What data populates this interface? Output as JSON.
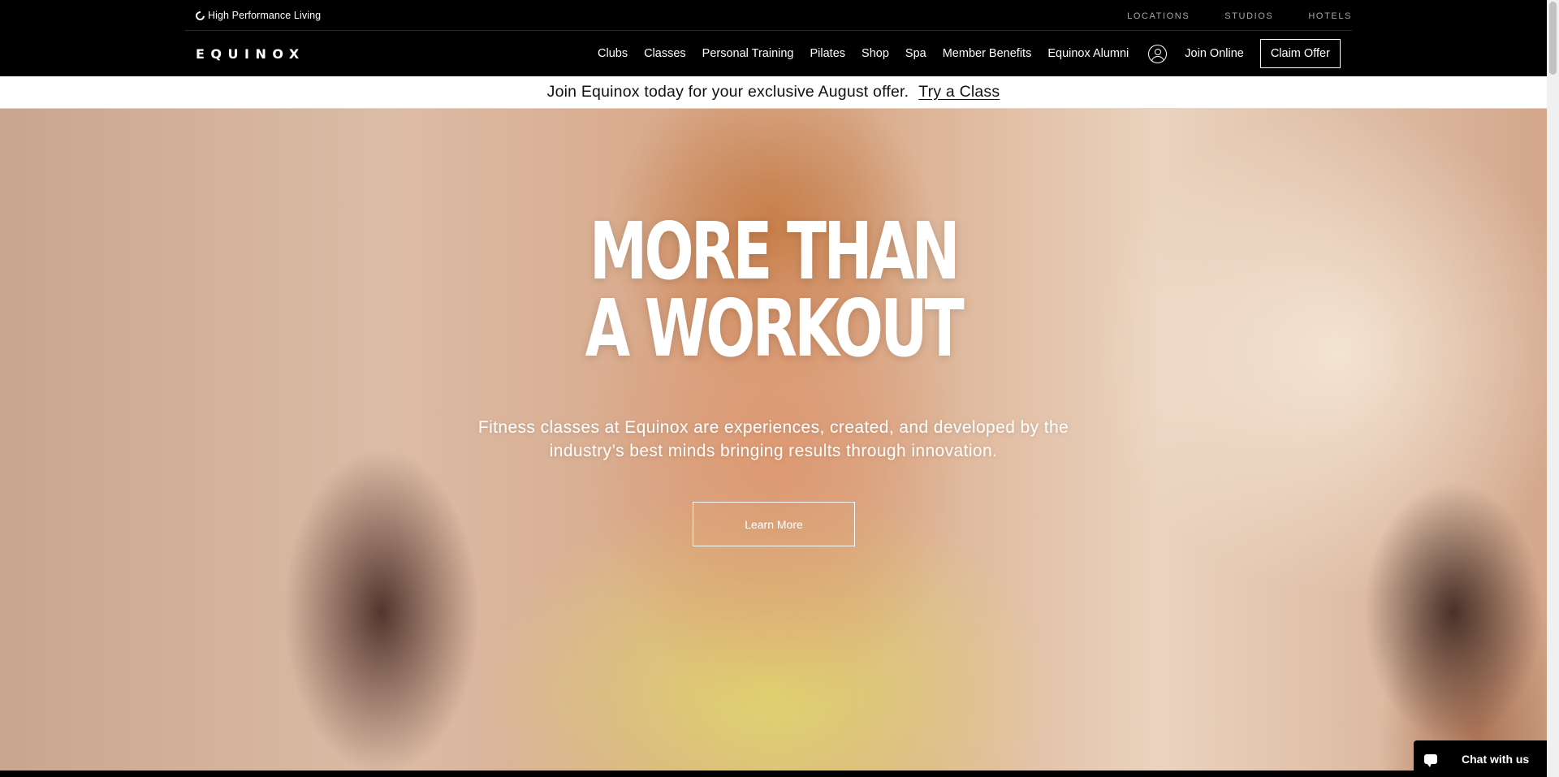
{
  "utility_bar": {
    "tagline": "High Performance Living",
    "links": [
      "LOCATIONS",
      "STUDIOS",
      "HOTELS"
    ]
  },
  "nav": {
    "logo": "EQUINOX",
    "items": [
      "Clubs",
      "Classes",
      "Personal Training",
      "Pilates",
      "Shop",
      "Spa",
      "Member Benefits",
      "Equinox Alumni"
    ],
    "join_online": "Join Online",
    "claim_offer": "Claim Offer"
  },
  "promo": {
    "text": "Join Equinox today for your exclusive August offer.",
    "link": "Try a Class"
  },
  "hero": {
    "headline_line1": "MORE THAN",
    "headline_line2": "A WORKOUT",
    "subhead_line1": "Fitness classes at Equinox are experiences, created, and developed by the",
    "subhead_line2": "industry’s best minds bringing results through innovation.",
    "cta": "Learn More"
  },
  "chat": {
    "label": "Chat with us"
  },
  "colors": {
    "nav_background": "#000000",
    "banner_background": "#ffffff",
    "text_on_dark": "#ffffff",
    "utility_link": "#a6a6a6"
  },
  "icons": [
    "circle-icon",
    "account-icon",
    "chat-bubble-icon"
  ]
}
